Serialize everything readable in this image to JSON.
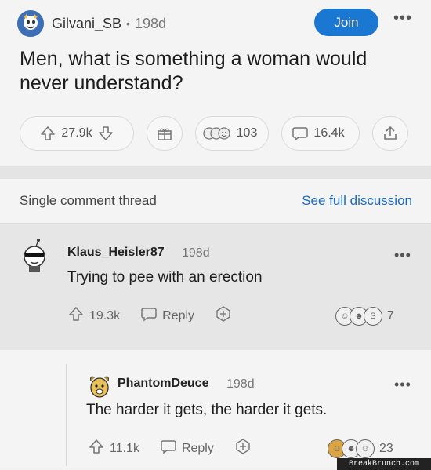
{
  "post": {
    "subreddit_user": "Gilvani_SB",
    "separator": "•",
    "age": "198d",
    "join_label": "Join",
    "more": "•••",
    "title": "Men, what is something a woman would never understand?",
    "upvotes": "27.9k",
    "awards_count": "103",
    "comments": "16.4k"
  },
  "thread": {
    "label": "Single comment thread",
    "full_link": "See full discussion"
  },
  "comment1": {
    "author": "Klaus_Heisler87",
    "age": "198d",
    "more": "•••",
    "body": "Trying to pee with an erection",
    "upvotes": "19.3k",
    "reply": "Reply",
    "awards_count": "7"
  },
  "comment2": {
    "author": "PhantomDeuce",
    "age": "198d",
    "more": "•••",
    "body": "The harder it gets, the harder it gets.",
    "upvotes": "11.1k",
    "reply": "Reply",
    "awards_count": "23"
  },
  "watermark": "BreakBrunch.com",
  "colors": {
    "accent": "#1a78d2",
    "link": "#1a6bc6",
    "highlight_bg": "#e6e6e6"
  }
}
